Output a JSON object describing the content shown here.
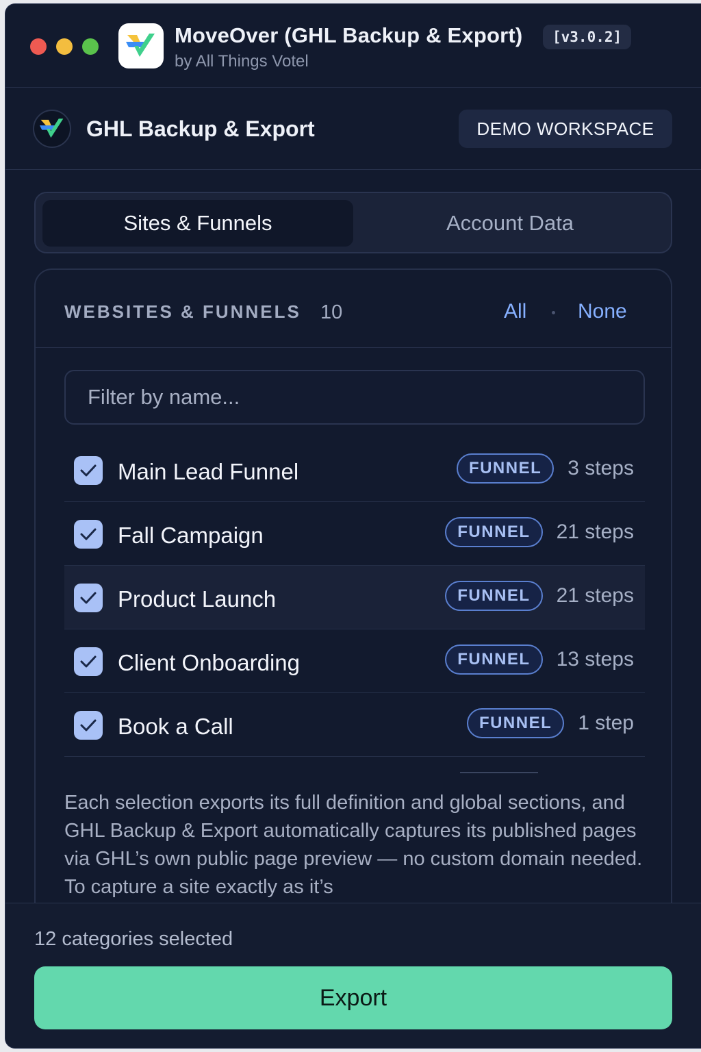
{
  "window": {
    "app_title": "MoveOver (GHL Backup & Export)",
    "version": "[v3.0.2]",
    "subtitle": "by All Things Votel"
  },
  "header": {
    "title": "GHL Backup & Export",
    "workspace": "DEMO WORKSPACE"
  },
  "tabs": [
    {
      "label": "Sites & Funnels",
      "active": true
    },
    {
      "label": "Account Data",
      "active": false
    }
  ],
  "panel": {
    "section_label": "WEBSITES & FUNNELS",
    "count": "10",
    "select_all": "All",
    "select_none": "None",
    "filter_placeholder": "Filter by name...",
    "items": [
      {
        "name": "Main Lead Funnel",
        "type": "FUNNEL",
        "steps": "3 steps",
        "checked": true
      },
      {
        "name": "Fall Campaign",
        "type": "FUNNEL",
        "steps": "21 steps",
        "checked": true
      },
      {
        "name": "Product Launch",
        "type": "FUNNEL",
        "steps": "21 steps",
        "checked": true
      },
      {
        "name": "Client Onboarding",
        "type": "FUNNEL",
        "steps": "13 steps",
        "checked": true
      },
      {
        "name": "Book a Call",
        "type": "FUNNEL",
        "steps": "1 step",
        "checked": true
      }
    ],
    "info": "Each selection exports its full definition and global sections, and GHL Backup & Export automatically captures its published pages via GHL’s own public page preview — no custom domain needed. To capture a site exactly as it’s"
  },
  "footer": {
    "selected_text": "12 categories selected",
    "export_label": "Export"
  },
  "colors": {
    "accent": "#63d8ad",
    "link": "#86b0ff",
    "checkbox": "#a9c1f6",
    "background": "#121a2e"
  }
}
